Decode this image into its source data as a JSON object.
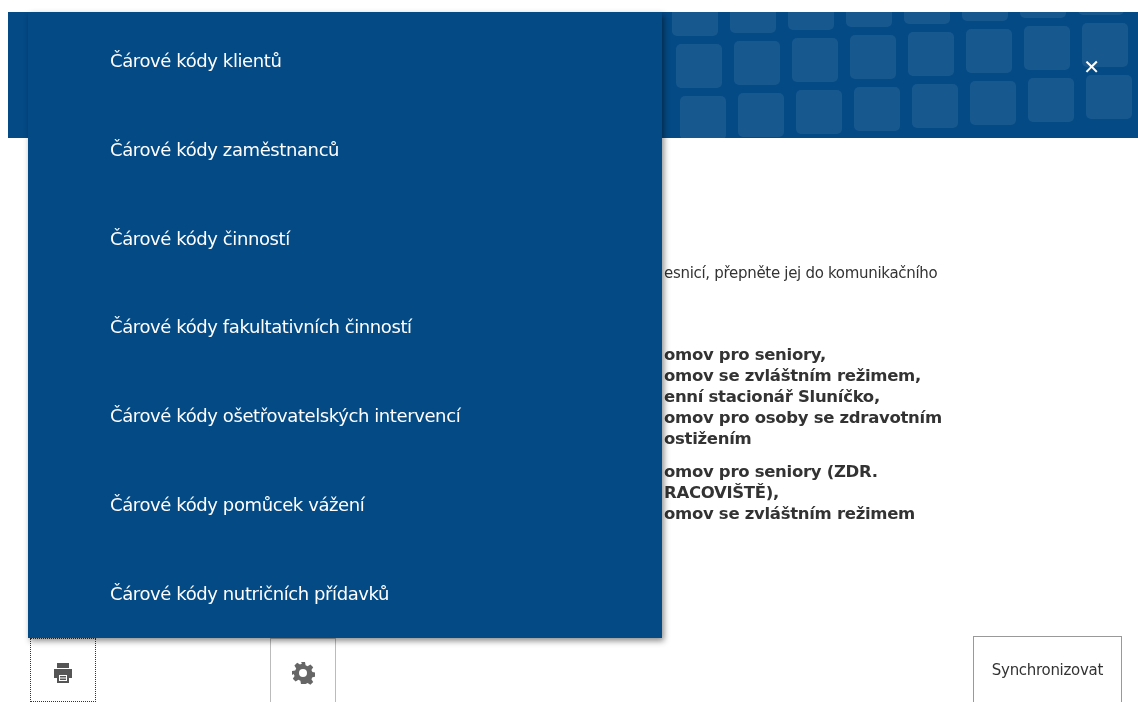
{
  "header": {
    "close": "✕"
  },
  "menu": {
    "items": [
      {
        "label": "Čárové kódy klientů"
      },
      {
        "label": "Čárové kódy zaměstnanců"
      },
      {
        "label": "Čárové kódy činností"
      },
      {
        "label": "Čárové kódy fakultativních činností"
      },
      {
        "label": "Čárové kódy ošetřovatelských intervencí"
      },
      {
        "label": "Čárové kódy pomůcek vážení"
      },
      {
        "label": "Čárové kódy nutričních přídavků"
      }
    ]
  },
  "content": {
    "instruction": "esnicí, přepněte jej do komunikačního",
    "groups": [
      {
        "lines": [
          "omov pro seniory,",
          "omov se zvláštním režimem,",
          "enní stacionář Sluníčko,",
          "omov pro osoby se zdravotním",
          "ostižením"
        ]
      },
      {
        "lines": [
          "omov pro seniory (ZDR.",
          "RACOVIŠTĚ),",
          "omov se zvláštním režimem"
        ]
      }
    ]
  },
  "toolbar": {
    "sync_button": "Synchronizovat"
  }
}
